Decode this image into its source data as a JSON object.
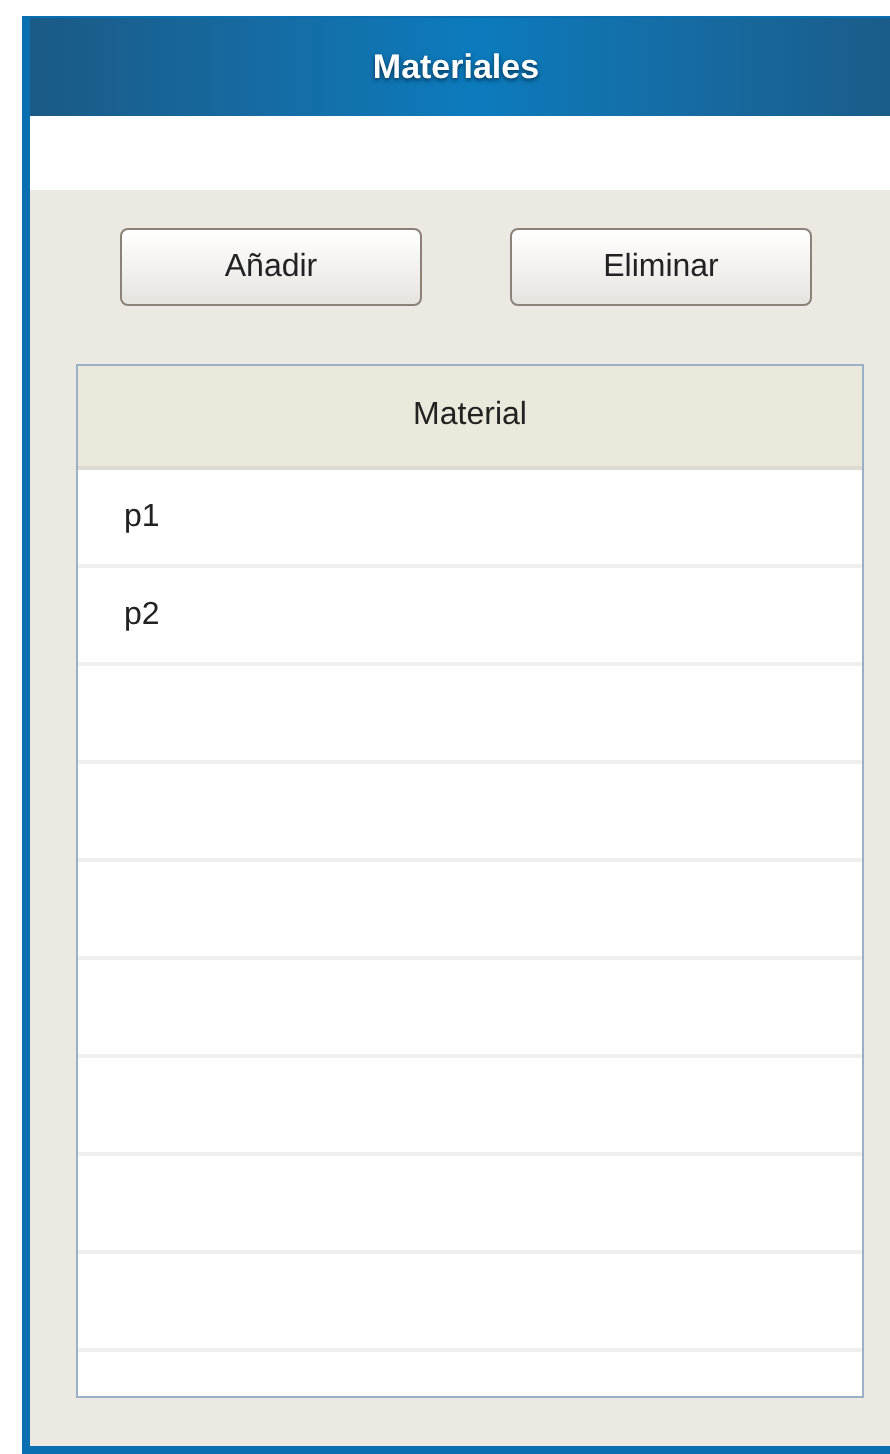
{
  "window": {
    "title": "Materiales"
  },
  "buttons": [
    "Añadir",
    "Eliminar"
  ],
  "table": {
    "columns": [
      "Material"
    ],
    "rows": [
      "p1",
      "p2"
    ]
  }
}
